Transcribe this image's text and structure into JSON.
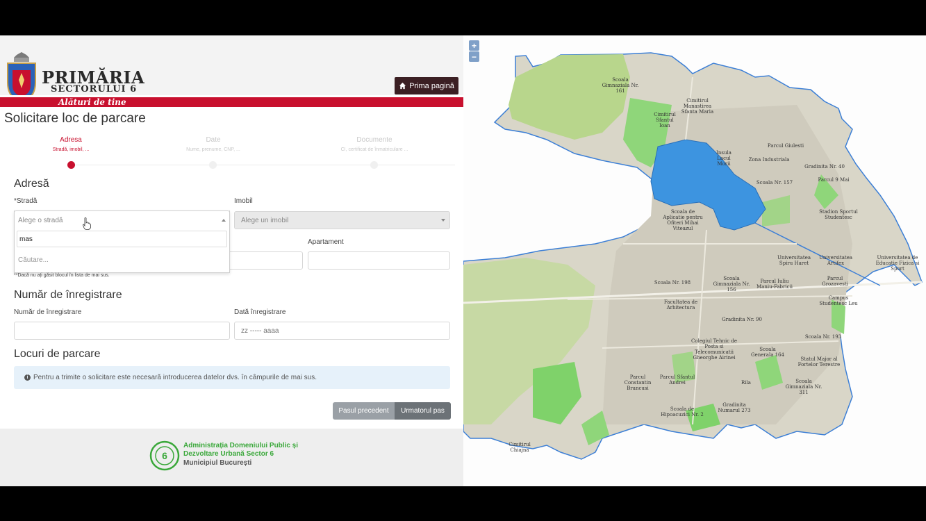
{
  "header": {
    "brand_line1": "PRIMĂRIA",
    "brand_line2": "SECTORULUI 6",
    "tagline": "Alături de tine",
    "home_button": "Prima pagină"
  },
  "page_title": "Solicitare loc de parcare",
  "steps": [
    {
      "label": "Adresa",
      "sub": "Stradă, imobil, ..."
    },
    {
      "label": "Date",
      "sub": "Nume, prenume, CNP, ..."
    },
    {
      "label": "Documente",
      "sub": "CI, certificat de înmatriculare ..."
    }
  ],
  "address": {
    "heading": "Adresă",
    "street_label": "*Stradă",
    "street_placeholder": "Alege o stradă",
    "street_search_value": "mas",
    "street_search_hint": "Căutare...",
    "building_label": "Imobil",
    "building_placeholder": "Alege un imobil",
    "apartment_label": "Apartament",
    "note": "**Dacă nu ați găsit blocul în lista de mai sus."
  },
  "registration": {
    "heading": "Număr de înregistrare",
    "number_label": "Număr de înregistrare",
    "date_label": "Dată înregistrare",
    "date_placeholder": "zz ----- aaaa"
  },
  "parking": {
    "heading": "Locuri de parcare",
    "info": "Pentru a trimite o solicitare este necesară introducerea datelor dvs. în câmpurile de mai sus."
  },
  "buttons": {
    "prev": "Pasul precedent",
    "next": "Urmatorul pas"
  },
  "footer": {
    "line1": "Administrația Domeniului Public și",
    "line2": "Dezvoltare Urbană Sector 6",
    "line3": "Municipiul București",
    "logo_number": "6"
  },
  "map": {
    "zoom_in": "+",
    "zoom_out": "−",
    "labels": [
      "Scoala Gimnaziala Nr. 161",
      "Cimitirul Sfantul Ioan",
      "Cimitirul Manastirea Sfanta Maria",
      "Parcul Giulesti",
      "Insula Lacul Morii",
      "Zona Industriala",
      "Gradinita Nr. 40",
      "Scoala Nr. 157",
      "Parcul 9 Mai",
      "Stadion Sportul Studentesc",
      "Scoala de Aplicatie pentru Ofiteri Mihai Viteazul",
      "Universitatea Spiru Haret",
      "Universitatea Artifex",
      "Universitatea de Educatie Fizica si Sport",
      "Scoala Nr. 198",
      "Scoala Gimnaziala Nr. 156",
      "Parcul Iuliu Maniu-Fabricii",
      "Parcul Grozavesti",
      "Facultatea de Arhitectura",
      "Campus Studentesc Leu",
      "Gradinita Nr. 90",
      "Scoala Nr. 193",
      "Colegiul Tehnic de Posta si Telecomunicatii Gheorghe Airinei",
      "Scoala Generala 164",
      "Statul Major al Fortelor Terestre",
      "Parcul Constantin Brancusi",
      "Parcul Sfantul Andrei",
      "Rila",
      "Scoala Gimnaziala Nr. 311",
      "Scoala de Hipoacuzici Nr. 2",
      "Gradinita Numarul 273",
      "Cimitirul Chiajna"
    ]
  }
}
